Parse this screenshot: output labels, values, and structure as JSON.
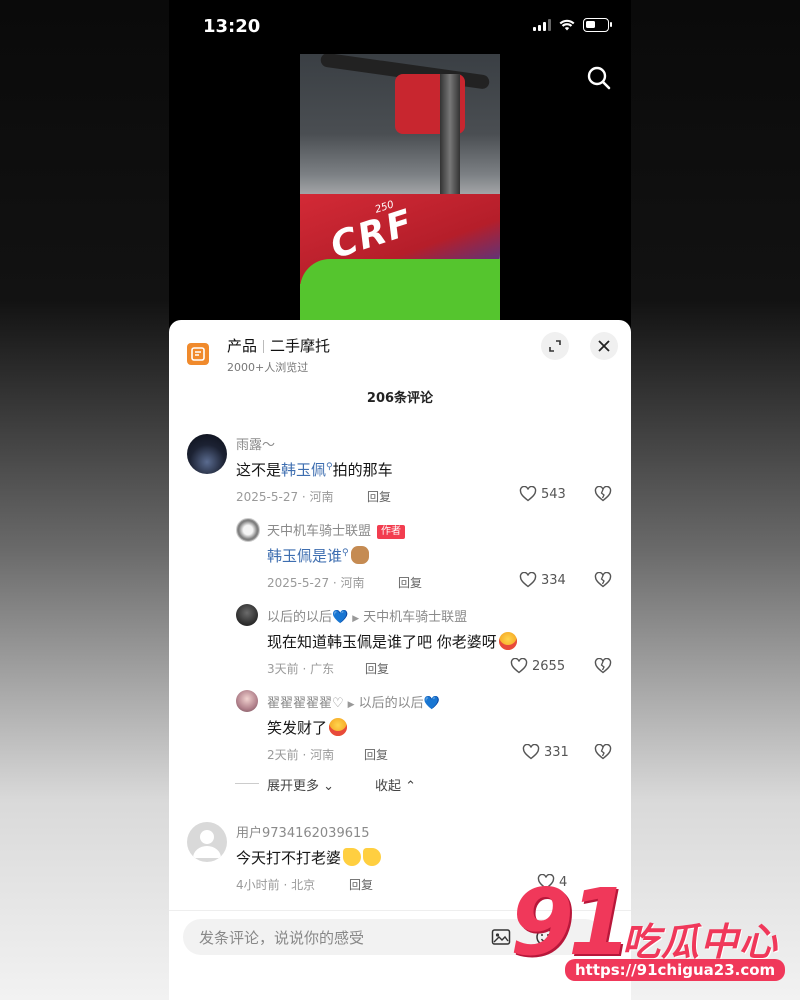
{
  "status_bar": {
    "time": "13:20"
  },
  "header": {
    "category": "产品",
    "title": "二手摩托",
    "views": "2000+人浏览过"
  },
  "comments_count": "206条评论",
  "video": {
    "model_text": "CRF",
    "model_number": "250"
  },
  "comments": [
    {
      "user": "雨露～",
      "text_before": "这不是",
      "link": "韩玉佩",
      "text_after": "拍的那车",
      "meta": "2025-5-27 · 河南",
      "reply": "回复",
      "likes": "543"
    },
    {
      "user": "天中机车骑士联盟",
      "badge": "作者",
      "link": "韩玉佩是谁",
      "meta": "2025-5-27 · 河南",
      "reply": "回复",
      "likes": "334"
    },
    {
      "user": "以后的以后💙",
      "reply_to": "天中机车骑士联盟",
      "text": "现在知道韩玉佩是谁了吧 你老婆呀",
      "meta": "3天前 · 广东",
      "reply": "回复",
      "likes": "2655"
    },
    {
      "user": "翟翟翟翟翟♡",
      "reply_to": "以后的以后💙",
      "text": "笑发财了",
      "meta": "2天前 · 河南",
      "reply": "回复",
      "likes": "331"
    },
    {
      "user": "用户9734162039615",
      "text": "今天打不打老婆",
      "meta": "4小时前 · 北京",
      "reply": "回复",
      "likes": "4"
    }
  ],
  "thread_controls": {
    "expand_more": "展开更多",
    "collapse": "收起"
  },
  "input": {
    "placeholder": "发条评论，说说你的感受"
  },
  "watermark": {
    "number": "91",
    "name": "吃瓜中心",
    "url": "https://91chigua23.com"
  },
  "colors": {
    "link": "#3e6eb0",
    "badge": "#f23d4f",
    "watermark": "#f0385a"
  },
  "icons": [
    "search-icon",
    "expand-icon",
    "close-icon",
    "heart-icon",
    "broken-heart-icon",
    "image-icon",
    "emoji-icon"
  ]
}
